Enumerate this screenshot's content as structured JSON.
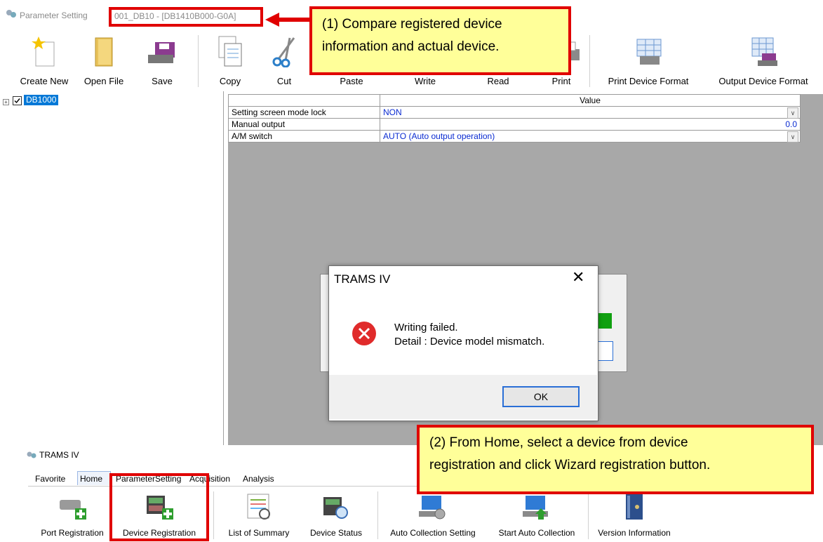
{
  "window": {
    "title": "Parameter Setting",
    "path": "001_DB10 - [DB1410B000-G0A]"
  },
  "toolbar": {
    "items": [
      {
        "label": "Create New",
        "icon": "create-new-icon"
      },
      {
        "label": "Open File",
        "icon": "open-folder-icon"
      },
      {
        "label": "Save",
        "icon": "save-disk-icon"
      },
      {
        "label": "Copy",
        "icon": "copy-document-icon"
      },
      {
        "label": "Cut",
        "icon": "scissors-icon"
      },
      {
        "label": "Paste",
        "icon": "paste-icon"
      },
      {
        "label": "Write",
        "icon": "write-icon"
      },
      {
        "label": "Read",
        "icon": "read-icon"
      },
      {
        "label": "Print",
        "icon": "printer-icon"
      },
      {
        "label": "Print Device Format",
        "icon": "print-format-icon"
      },
      {
        "label": "Output Device Format",
        "icon": "output-format-icon"
      }
    ]
  },
  "tree": {
    "root": {
      "label": "DB1000",
      "checked": true,
      "expander": "+"
    }
  },
  "grid": {
    "header": "Value",
    "rows": [
      {
        "name": "Setting screen mode lock",
        "value": "NON",
        "dropdown": true
      },
      {
        "name": "Manual output",
        "value": "0.0",
        "dropdown": false
      },
      {
        "name": "A/M switch",
        "value": "AUTO (Auto output operation)",
        "dropdown": true
      }
    ]
  },
  "dialog": {
    "title": "TRAMS IV",
    "close": "✕",
    "message_line1": "Writing failed.",
    "message_line2": "Detail : Device model mismatch.",
    "ok_label": "OK",
    "icon": "error-icon"
  },
  "callouts": {
    "c1_line1": "(1) Compare registered device",
    "c1_line2": "information and actual device.",
    "c2_line1": "(2) From Home, select a device from device",
    "c2_line2": "registration and click Wizard registration button."
  },
  "main_window": {
    "title": "TRAMS IV",
    "menu": [
      "Favorite",
      "Home",
      "ParameterSetting",
      "Acquisition",
      "Analysis"
    ],
    "ribbon": [
      {
        "label": "Port Registration",
        "icon": "port-registration-icon"
      },
      {
        "label": "Device Registration",
        "icon": "device-registration-icon"
      },
      {
        "label": "List of Summary",
        "icon": "list-summary-icon"
      },
      {
        "label": "Device Status",
        "icon": "device-status-icon"
      },
      {
        "label": "Auto Collection Setting",
        "icon": "auto-collection-setting-icon"
      },
      {
        "label": "Start Auto Collection",
        "icon": "start-auto-collection-icon"
      },
      {
        "label": "Version Information",
        "icon": "version-info-icon"
      }
    ]
  },
  "colors": {
    "accent_red": "#e00000",
    "callout_fill": "#ffff99",
    "value_blue": "#0a2bd1",
    "selection_blue": "#0078d7",
    "error_red": "#e02b2b"
  }
}
